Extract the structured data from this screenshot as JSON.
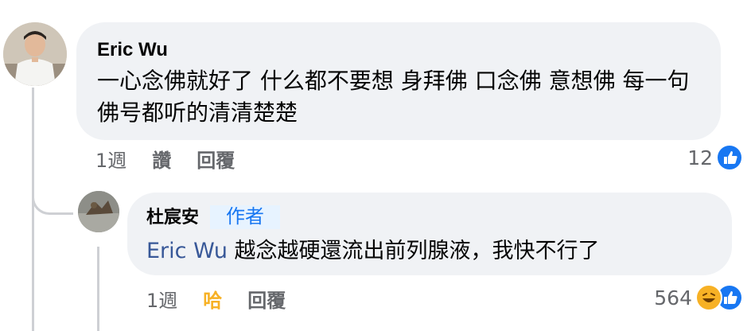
{
  "comments": [
    {
      "author": "Eric Wu",
      "text": "一心念佛就好了 什么都不要想 身拜佛 口念佛 意想佛 每一句佛号都听的清清楚楚",
      "time": "1週",
      "like_label": "讚",
      "reply_label": "回覆",
      "reaction_count": "12",
      "reactions": [
        "like-icon"
      ]
    },
    {
      "author": "杜宸安",
      "badge": "作者",
      "mention": "Eric Wu",
      "text": " 越念越硬還流出前列腺液，我快不行了",
      "time": "1週",
      "like_label": "哈",
      "reply_label": "回覆",
      "reaction_count": "564",
      "reactions": [
        "haha-icon",
        "like-icon"
      ]
    }
  ],
  "colors": {
    "bubble": "#f0f2f5",
    "meta_text": "#65676b",
    "link": "#385898",
    "badge_bg": "#e7f3ff",
    "badge_text": "#1877f2",
    "haha": "#f7b125",
    "like": "#1877f2"
  }
}
